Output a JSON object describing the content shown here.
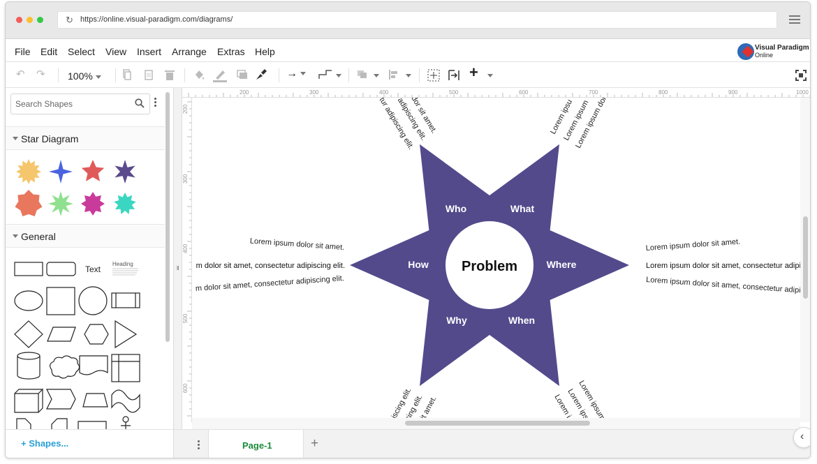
{
  "browser": {
    "url": "https://online.visual-paradigm.com/diagrams/"
  },
  "menu": {
    "items": [
      "File",
      "Edit",
      "Select",
      "View",
      "Insert",
      "Arrange",
      "Extras",
      "Help"
    ],
    "logo_line1": "Visual Paradigm",
    "logo_line2": "Online"
  },
  "toolbar": {
    "zoom": "100%"
  },
  "sidebar": {
    "search_placeholder": "Search Shapes",
    "section_star": "Star Diagram",
    "section_general": "General",
    "general_text_label": "Text",
    "general_heading_label": "Heading",
    "shapes_link": "Shapes...",
    "star_colors": [
      "#f5c66b",
      "#4a63e0",
      "#e05a5a",
      "#5b4a8c",
      "#e8775e",
      "#8fe08f",
      "#c93b9b",
      "#3bd6c1"
    ]
  },
  "ruler": {
    "top": [
      "200",
      "300",
      "400",
      "500",
      "600",
      "700",
      "800",
      "900",
      "1000"
    ],
    "left": [
      "200",
      "300",
      "400",
      "500",
      "600"
    ]
  },
  "diagram": {
    "center_label": "Problem",
    "points": [
      "Who",
      "What",
      "Where",
      "When",
      "Why",
      "How"
    ],
    "star_color": "#534a8c",
    "lorem_short": "Lorem ipsum dolor sit amet.",
    "lorem_long": "Lorem ipsum dolor sit amet, consectetur adipiscing elit.",
    "left_lines": [
      "Lorem ipsum dolor sit amet.",
      "m dolor sit amet, consectetur adipiscing elit.",
      "m dolor sit amet, consectetur adipiscing elit."
    ],
    "right_lines": [
      "Lorem ipsum dolor sit amet.",
      "Lorem ipsum dolor sit amet, consectetur adipis",
      "Lorem ipsum dolor sit amet, consectetur adipis"
    ],
    "top_left_lines": [
      "dor sit amet.",
      "adipiscing elit.",
      "tur adipiscing elit."
    ],
    "top_right_lines": [
      "Lorem ipsu",
      "Lorem ipsum",
      "Lorem ipsum dolo"
    ],
    "bottom_left_lines": [
      "dipiscing elit.",
      "scing elit.",
      "sit amet."
    ],
    "bottom_right_lines": [
      "Lorem ipsum",
      "Lorem ips",
      "Lorem i"
    ]
  },
  "pages": {
    "current": "Page-1"
  }
}
